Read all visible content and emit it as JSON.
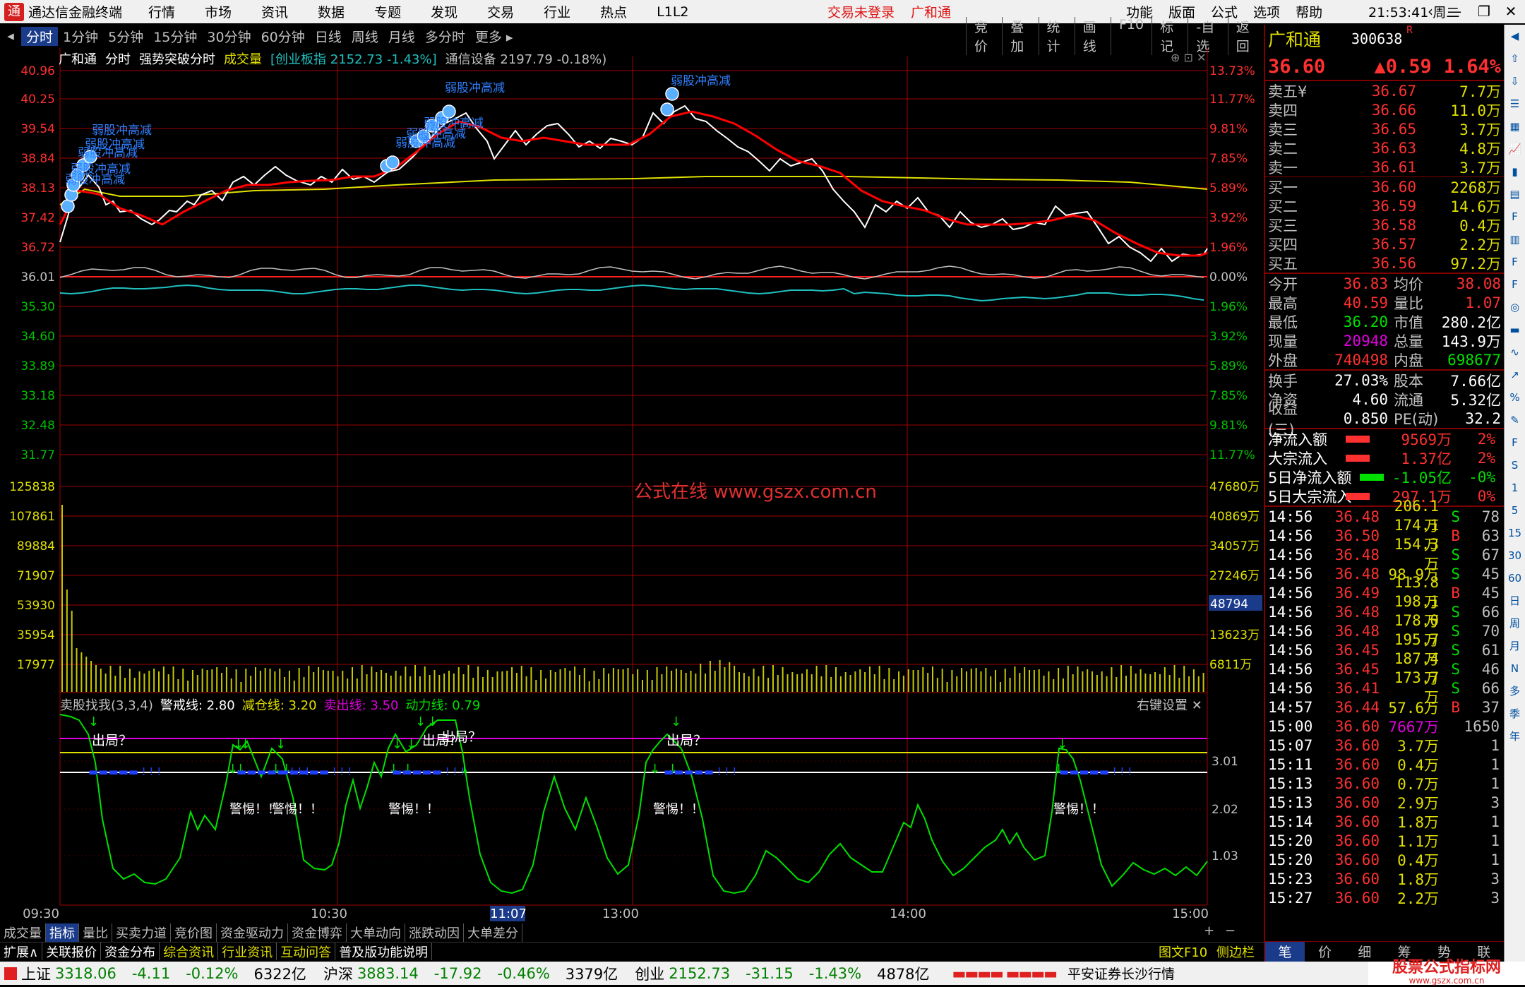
{
  "window": {
    "title": "通达信金融终端",
    "login_status": "交易未登录",
    "broker": "广和通",
    "clock": "21:53:41",
    "weekday": "周二"
  },
  "menu": {
    "items": [
      "行情",
      "市场",
      "资讯",
      "数据",
      "专题",
      "发现",
      "交易",
      "行业",
      "热点",
      "L1L2"
    ],
    "right": [
      "功能",
      "版面",
      "公式",
      "选项",
      "帮助"
    ]
  },
  "timeframes": [
    "分时",
    "1分钟",
    "5分钟",
    "15分钟",
    "30分钟",
    "60分钟",
    "日线",
    "周线",
    "月线",
    "多分时",
    "更多"
  ],
  "tools": [
    "竞价",
    "叠加",
    "统计",
    "画线",
    "F10",
    "标记",
    "-自选",
    "返回"
  ],
  "chart_header": {
    "stock": "广和通",
    "mode": "分时",
    "formula": "强势突破分时",
    "volume_label": "成交量",
    "index_label": "创业板指",
    "index_value": "2152.73",
    "index_pct": "-1.43%",
    "sector": "通信设备",
    "sector_value": "2197.79",
    "sector_pct": "-0.18%"
  },
  "price_axis": {
    "left": [
      "40.96",
      "40.25",
      "39.54",
      "38.84",
      "38.13",
      "37.42",
      "36.72",
      "36.01",
      "35.30",
      "34.60",
      "33.89",
      "33.18",
      "32.48",
      "31.77"
    ],
    "right": [
      "13.73%",
      "11.77%",
      "9.81%",
      "7.85%",
      "5.89%",
      "3.92%",
      "1.96%",
      "0.00%",
      "1.96%",
      "3.92%",
      "5.89%",
      "7.85%",
      "9.81%",
      "11.77%"
    ]
  },
  "volume_axis": {
    "left": [
      "125838",
      "107861",
      "89884",
      "71907",
      "53930",
      "35954",
      "17977"
    ],
    "right": [
      "47680万",
      "40869万",
      "34057万",
      "27246万",
      "20434万",
      "13623万",
      "6811万"
    ],
    "highlight": "48794"
  },
  "signal_labels": {
    "weak": "弱股冲高减",
    "exit": "出局？",
    "warn": "警惕！！"
  },
  "watermark": "公式在线  www.gszx.com.cn",
  "indicator": {
    "name": "卖股找我(3,3,4)",
    "l1": "警戒线: 2.80",
    "l2": "减仓线: 3.20",
    "l3": "卖出线: 3.50",
    "l4": "动力线: 0.79",
    "settings": "右键设置",
    "axis": [
      "3.01",
      "2.02",
      "1.03"
    ]
  },
  "time_axis": [
    "09:30",
    "10:30",
    "11:07",
    "13:00",
    "14:00",
    "15:00"
  ],
  "bottom_tabs1": [
    "成交量",
    "指标",
    "量比",
    "买卖力道",
    "竞价图",
    "资金驱动力",
    "资金博弈",
    "大单动向",
    "涨跌动因",
    "大单差分"
  ],
  "bottom_tabs2": [
    "扩展∧",
    "关联报价",
    "资金分布",
    "综合资讯",
    "行业资讯",
    "互动问答",
    "普及版功能说明"
  ],
  "bottom_right": [
    "图文F10",
    "侧边栏《"
  ],
  "panel_tabs": [
    "笔",
    "价",
    "细",
    "筹",
    "势",
    "联"
  ],
  "quote": {
    "name": "广和通",
    "code": "300638",
    "r": "R",
    "price": "36.60",
    "change": "▲0.59",
    "pct": "1.64%"
  },
  "sells": [
    [
      "卖五¥",
      "36.67",
      "7.7万"
    ],
    [
      "卖四",
      "36.66",
      "11.0万"
    ],
    [
      "卖三",
      "36.65",
      "3.7万"
    ],
    [
      "卖二",
      "36.63",
      "4.8万"
    ],
    [
      "卖一",
      "36.61",
      "3.7万"
    ]
  ],
  "buys": [
    [
      "买一",
      "36.60",
      "2268万"
    ],
    [
      "买二",
      "36.59",
      "14.6万"
    ],
    [
      "买三",
      "36.58",
      "0.4万"
    ],
    [
      "买四",
      "36.57",
      "2.2万"
    ],
    [
      "买五",
      "36.56",
      "97.2万"
    ]
  ],
  "stats": [
    [
      "今开",
      "36.83",
      "均价",
      "38.08"
    ],
    [
      "最高",
      "40.59",
      "量比",
      "1.07"
    ],
    [
      "最低",
      "36.20",
      "市值",
      "280.2亿"
    ],
    [
      "现量",
      "20948",
      "总量",
      "143.9万"
    ],
    [
      "外盘",
      "740498",
      "内盘",
      "698677"
    ]
  ],
  "stats2": [
    [
      "换手",
      "27.03%",
      "股本",
      "7.66亿"
    ],
    [
      "净资",
      "4.60",
      "流通",
      "5.32亿"
    ],
    [
      "收益(三)",
      "0.850",
      "PE(动)",
      "32.2"
    ]
  ],
  "flows": [
    [
      "净流入额",
      "9569万",
      "2%"
    ],
    [
      "大宗流入",
      "1.37亿",
      "2%"
    ],
    [
      "5日净流入额",
      "-1.05亿",
      "-0%"
    ],
    [
      "5日大宗流入",
      "297.1万",
      "0%"
    ]
  ],
  "ticks": [
    [
      "14:56",
      "36.48",
      "206.1万",
      "S",
      "78"
    ],
    [
      "14:56",
      "36.50",
      "174.1万",
      "B",
      "63"
    ],
    [
      "14:56",
      "36.48",
      "154.3万",
      "S",
      "67"
    ],
    [
      "14:56",
      "36.48",
      "98.9万",
      "S",
      "45"
    ],
    [
      "14:56",
      "36.49",
      "113.8万",
      "B",
      "45"
    ],
    [
      "14:56",
      "36.48",
      "198.1万",
      "S",
      "66"
    ],
    [
      "14:56",
      "36.48",
      "178.0万",
      "S",
      "70"
    ],
    [
      "14:56",
      "36.45",
      "195.7万",
      "S",
      "61"
    ],
    [
      "14:56",
      "36.45",
      "187.4万",
      "S",
      "46"
    ],
    [
      "14:56",
      "36.41",
      "173.7万",
      "S",
      "66"
    ],
    [
      "14:57",
      "36.44",
      "57.6万",
      "B",
      "37"
    ],
    [
      "15:00",
      "36.60",
      "7667万",
      "",
      "1650"
    ],
    [
      "15:07",
      "36.60",
      "3.7万",
      "",
      "1"
    ],
    [
      "15:11",
      "36.60",
      "0.4万",
      "",
      "1"
    ],
    [
      "15:13",
      "36.60",
      "0.7万",
      "",
      "1"
    ],
    [
      "15:13",
      "36.60",
      "2.9万",
      "",
      "3"
    ],
    [
      "15:14",
      "36.60",
      "1.8万",
      "",
      "1"
    ],
    [
      "15:20",
      "36.60",
      "1.1万",
      "",
      "1"
    ],
    [
      "15:20",
      "36.60",
      "0.4万",
      "",
      "1"
    ],
    [
      "15:23",
      "36.60",
      "1.8万",
      "",
      "3"
    ],
    [
      "15:27",
      "36.60",
      "2.2万",
      "",
      "3"
    ]
  ],
  "sidebar": [
    "1",
    "5",
    "15",
    "30",
    "60",
    "日",
    "周",
    "月",
    "N",
    "多",
    "季",
    "年"
  ],
  "status": {
    "sh_name": "上证",
    "sh_val": "3318.06",
    "sh_chg": "-4.11",
    "sh_pct": "-0.12%",
    "sh_amt": "6322亿",
    "sz_name": "沪深",
    "sz_val": "3883.14",
    "sz_chg": "-17.92",
    "sz_pct": "-0.46%",
    "sz_amt": "3379亿",
    "cy_name": "创业",
    "cy_val": "2152.73",
    "cy_chg": "-31.15",
    "cy_pct": "-1.43%",
    "cy_amt": "4878亿",
    "feed": "平安证券长沙行情",
    "brand": "股票公式指标网",
    "brand_url": "www.gszx.com.cn"
  },
  "colors": {
    "grid": "#a00000",
    "up": "#ff3030",
    "down": "#00e000",
    "price": "#ffffff",
    "avg": "#e0e000",
    "ma": "#ff0000",
    "volume": "#c8c800",
    "indicator": "#00e000",
    "label": "#0080ff",
    "magenta": "#e000e0"
  }
}
